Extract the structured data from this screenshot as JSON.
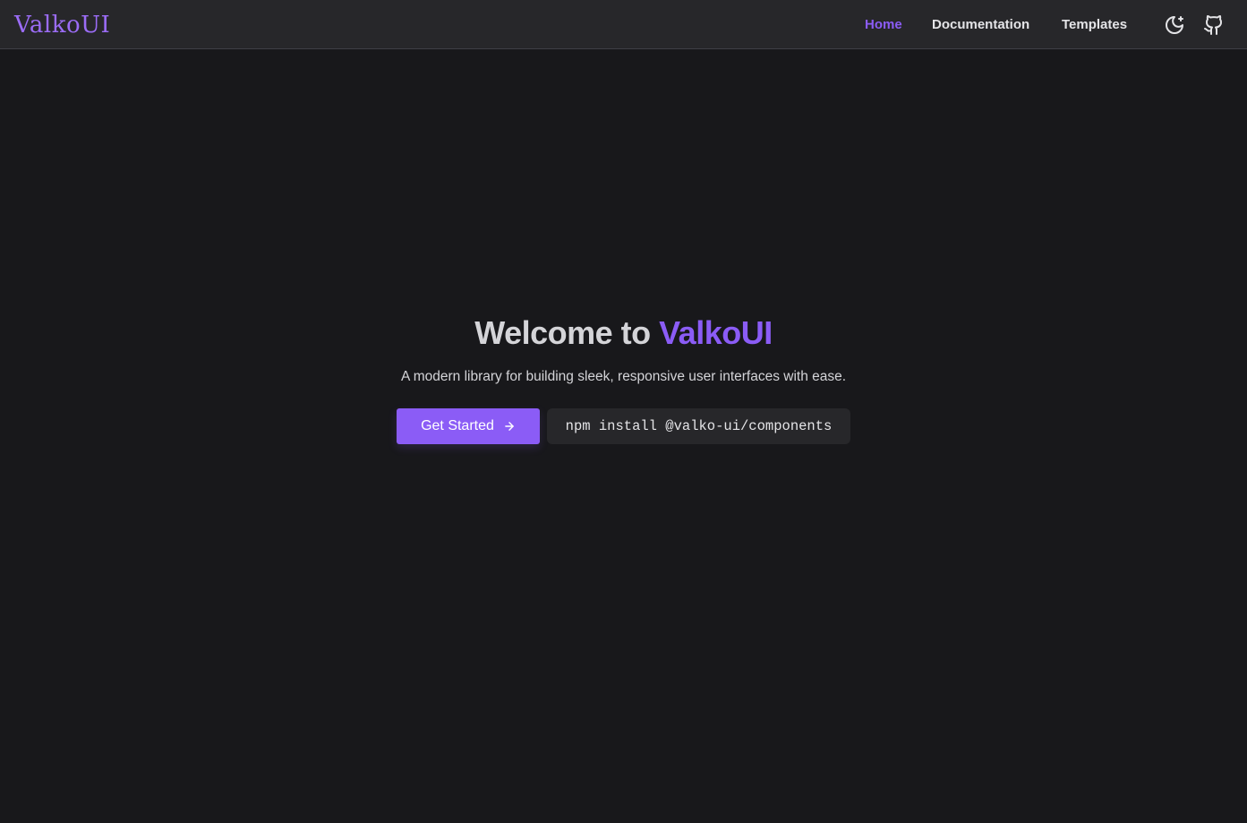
{
  "brand": {
    "name": "ValkoUI"
  },
  "nav": {
    "items": [
      {
        "label": "Home",
        "active": true
      },
      {
        "label": "Documentation",
        "active": false
      },
      {
        "label": "Templates",
        "active": false
      }
    ],
    "icons": {
      "theme_toggle": "moon-icon",
      "github": "github-icon"
    }
  },
  "hero": {
    "title_prefix": "Welcome to ",
    "title_accent": "ValkoUI",
    "subtitle": "A modern library for building sleek, responsive user interfaces with ease.",
    "cta_label": "Get Started",
    "cta_icon": "arrow-right-icon",
    "install_command": "npm install @valko-ui/components"
  },
  "colors": {
    "accent": "#8b5cf6",
    "background": "#18181b",
    "navbar": "#27272a",
    "text": "#e4e4e7"
  }
}
